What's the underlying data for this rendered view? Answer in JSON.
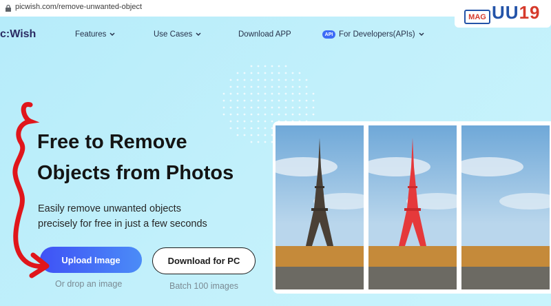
{
  "browser": {
    "url": "picwish.com/remove-unwanted-object",
    "icons": [
      "lock-icon",
      "share-icon",
      "star-icon",
      "extension-icon",
      "translate-icon",
      "puzzle-icon"
    ]
  },
  "nav": {
    "logo": "c:Wish",
    "features": "Features",
    "use_cases": "Use Cases",
    "download_app": "Download APP",
    "api_badge": "API",
    "developers": "For Developers(APIs)"
  },
  "watermark": {
    "box_text": "MAG",
    "logo_a": "UU",
    "logo_b": "19"
  },
  "hero": {
    "title_line1": "Free to Remove",
    "title_line2": "Objects from Photos",
    "subtitle_line1": "Easily remove unwanted objects",
    "subtitle_line2": "precisely for free in just a few seconds",
    "upload_label": "Upload Image",
    "drop_note": "Or drop an image",
    "download_pc_label": "Download for PC",
    "batch_note": "Batch 100 images"
  },
  "colors": {
    "accent": "#3f52f6",
    "annotation": "#e0161b",
    "highlight": "#e5393b"
  }
}
